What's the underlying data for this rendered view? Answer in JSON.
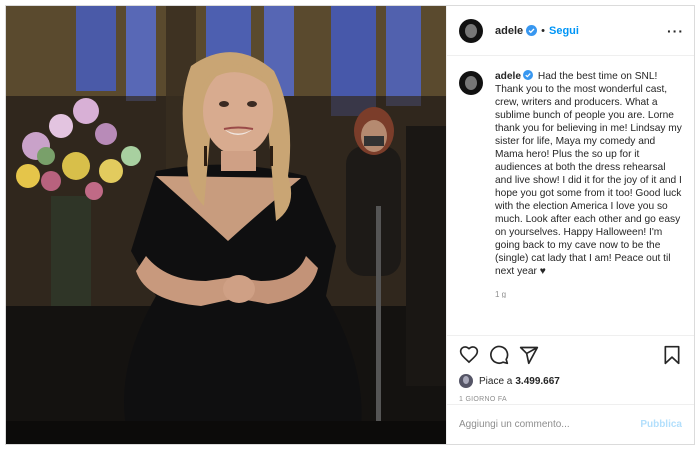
{
  "post": {
    "username": "adele",
    "follow_label": "Segui",
    "dot": "•",
    "more_label": "···",
    "caption_username": "adele",
    "caption": "Had the best time on SNL! Thank you to the most wonderful cast, crew, writers and producers. What a sublime bunch of people you are. Lorne thank you for believing in me! Lindsay my sister for life, Maya my comedy and Mama hero! Plus the so up for it audiences at both the dress rehearsal and live show! I did it for the joy of it and I hope you got some from it too! Good luck with the election America I love you so much. Look after each other and go easy on yourselves. Happy Halloween! I'm going back to my cave now to be the (single) cat lady that I am! Peace out til next year ♥",
    "caption_age": "1 g",
    "likes_prefix": "Piace a",
    "likes_count": "3.499.667",
    "date": "1 giorno fa",
    "comment_placeholder": "Aggiungi un commento...",
    "publish_label": "Pubblica"
  },
  "colors": {
    "accent": "#0095f6",
    "publish_disabled": "#b2dffc",
    "muted": "#8e8e8e",
    "text": "#262626"
  },
  "icons": [
    "verified-badge-icon",
    "more-options-icon",
    "heart-icon",
    "comment-icon",
    "share-icon",
    "bookmark-icon"
  ]
}
